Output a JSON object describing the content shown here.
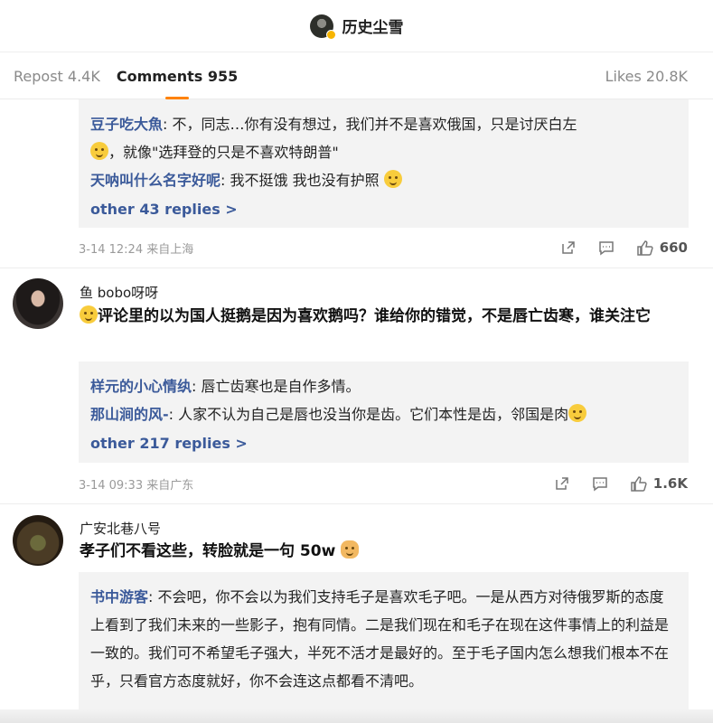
{
  "header": {
    "title": "历史尘雪",
    "avatar_icon": "profile-avatar"
  },
  "tabs": {
    "repost": "Repost 4.4K",
    "comments": "Comments 955",
    "likes": "Likes 20.8K"
  },
  "accent_color": "#ff8200",
  "link_color": "#3b5a9a",
  "comment1": {
    "replies": [
      {
        "name": "豆子吃大魚",
        "sep": ": ",
        "text": "不，同志…你有没有想过，我们并不是喜欢俄国，只是讨厌白左",
        "text2": "，就像\"选拜登的只是不喜欢特朗普\""
      },
      {
        "name": "天呐叫什么名字好呢",
        "sep": ": ",
        "text": "我不挺饿 我也没有护照"
      }
    ],
    "more_replies": "other 43 replies >",
    "time": "3-14 12:24 来自上海",
    "likes": "660"
  },
  "comment2": {
    "username": "鱼 bobo呀呀",
    "text": "评论里的以为国人挺鹅是因为喜欢鹅吗？谁给你的错觉，不是唇亡齿寒，谁关注它",
    "replies": [
      {
        "name": "样元的小心情纨",
        "sep": ": ",
        "text": "唇亡齿寒也是自作多情。"
      },
      {
        "name": "那山涧的风-",
        "sep": ": ",
        "text": "人家不认为自己是唇也没当你是齿。它们本性是齿，邻国是肉"
      }
    ],
    "more_replies": "other 217 replies >",
    "time": "3-14 09:33 来自广东",
    "likes": "1.6K"
  },
  "comment3": {
    "username": "广安北巷八号",
    "text": "孝子们不看这些，转脸就是一句 50w",
    "replies": [
      {
        "name": "书中游客",
        "sep": ": ",
        "text": "不会吧，你不会以为我们支持毛子是喜欢毛子吧。一是从西方对待俄罗斯的态度上看到了我们未来的一些影子，抱有同情。二是我们现在和毛子在现在这件事情上的利益是一致的。我们可不希望毛子强大，半死不活才是最好的。至于毛子国内怎么想我们根本不在乎，只看官方态度就好，你不会连这点都看不清吧。"
      }
    ]
  }
}
